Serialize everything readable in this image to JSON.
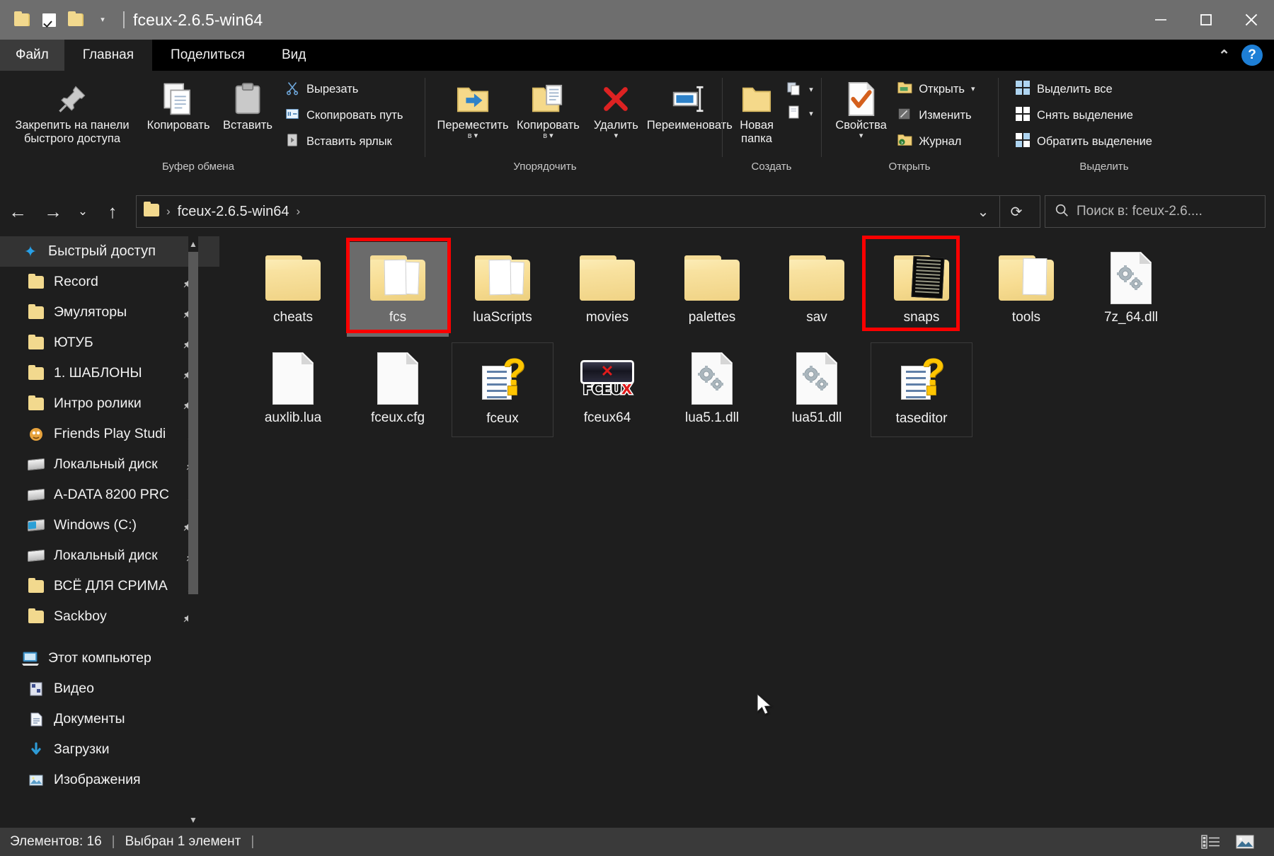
{
  "window": {
    "title": "fceux-2.6.5-win64",
    "quick_access_icons": [
      "folder-icon",
      "checkbox-icon",
      "folder-icon",
      "dropdown-caret-icon"
    ],
    "controls": {
      "minimize": "minimize-icon",
      "maximize": "maximize-icon",
      "close": "close-icon"
    }
  },
  "tabs": [
    {
      "label": "Файл",
      "id": "file"
    },
    {
      "label": "Главная",
      "id": "home",
      "active": true
    },
    {
      "label": "Поделиться",
      "id": "share"
    },
    {
      "label": "Вид",
      "id": "view"
    }
  ],
  "ribbon": {
    "collapse_icon": "chevron-up-icon",
    "help_icon": "help-icon",
    "help_label": "?",
    "groups": [
      {
        "label": "Буфер обмена",
        "big_buttons": [
          {
            "label": "Закрепить на панели\nбыстрого доступа",
            "icon": "pin-icon"
          },
          {
            "label": "Копировать",
            "icon": "copy-icon"
          },
          {
            "label": "Вставить",
            "icon": "paste-icon"
          }
        ],
        "small_buttons": [
          {
            "label": "Вырезать",
            "icon": "scissors-icon"
          },
          {
            "label": "Скопировать путь",
            "icon": "copy-path-icon"
          },
          {
            "label": "Вставить ярлык",
            "icon": "paste-shortcut-icon"
          }
        ]
      },
      {
        "label": "Упорядочить",
        "big_buttons": [
          {
            "label": "Переместить\nв",
            "icon": "move-to-icon",
            "has_caret": true
          },
          {
            "label": "Копировать\nв",
            "icon": "copy-to-icon",
            "has_caret": true
          },
          {
            "label": "Удалить",
            "icon": "delete-icon",
            "has_caret": true
          },
          {
            "label": "Переименовать",
            "icon": "rename-icon"
          }
        ]
      },
      {
        "label": "Создать",
        "big_buttons": [
          {
            "label": "Новая\nпапка",
            "icon": "new-folder-icon"
          }
        ],
        "split_items": [
          {
            "icon": "new-item-icon",
            "has_caret": true
          },
          {
            "icon": "easy-access-icon",
            "has_caret": true
          }
        ]
      },
      {
        "label": "Открыть",
        "big_buttons": [
          {
            "label": "Свойства",
            "icon": "properties-icon",
            "has_caret": true
          }
        ],
        "small_buttons": [
          {
            "label": "Открыть",
            "icon": "open-icon",
            "has_caret": true
          },
          {
            "label": "Изменить",
            "icon": "edit-icon"
          },
          {
            "label": "Журнал",
            "icon": "history-icon"
          }
        ]
      },
      {
        "label": "Выделить",
        "small_buttons": [
          {
            "label": "Выделить все",
            "icon": "select-all-icon"
          },
          {
            "label": "Снять выделение",
            "icon": "select-none-icon"
          },
          {
            "label": "Обратить выделение",
            "icon": "invert-selection-icon"
          }
        ]
      }
    ]
  },
  "navbar": {
    "back_icon": "back-arrow-icon",
    "forward_icon": "forward-arrow-icon",
    "recent_icon": "recent-locations-icon",
    "up_icon": "up-arrow-icon",
    "breadcrumbs": [
      "fceux-2.6.5-win64"
    ],
    "dropdown_icon": "chevron-down-icon",
    "refresh_icon": "refresh-icon",
    "search_icon": "search-icon",
    "search_placeholder": "Поиск в: fceux-2.6...."
  },
  "sidebar": {
    "quick_access": {
      "label": "Быстрый доступ",
      "icon": "star-icon",
      "items": [
        {
          "label": "Record",
          "icon": "folder-icon",
          "pinned": true
        },
        {
          "label": "Эмуляторы",
          "icon": "folder-icon",
          "pinned": true
        },
        {
          "label": "ЮТУБ",
          "icon": "folder-icon",
          "pinned": true
        },
        {
          "label": "1. ШАБЛОНЫ",
          "icon": "folder-icon",
          "pinned": true
        },
        {
          "label": "Интро ролики",
          "icon": "folder-icon",
          "pinned": true
        },
        {
          "label": "Friends Play Studi",
          "icon": "app-folder-icon",
          "pinned": true
        },
        {
          "label": "Локальный диск",
          "icon": "drive-icon",
          "pinned": true
        },
        {
          "label": "A-DATA 8200 PRC",
          "icon": "drive-icon",
          "pinned": true
        },
        {
          "label": "Windows (C:)",
          "icon": "windows-drive-icon",
          "pinned": true
        },
        {
          "label": "Локальный диск",
          "icon": "drive-icon",
          "pinned": true
        },
        {
          "label": "ВСЁ ДЛЯ СРИМА",
          "icon": "folder-icon",
          "pinned": true
        },
        {
          "label": "Sackboy",
          "icon": "folder-icon",
          "pinned": true
        }
      ]
    },
    "this_pc": {
      "label": "Этот компьютер",
      "icon": "computer-icon",
      "items": [
        {
          "label": "Видео",
          "icon": "videos-icon"
        },
        {
          "label": "Документы",
          "icon": "documents-icon"
        },
        {
          "label": "Загрузки",
          "icon": "downloads-icon"
        },
        {
          "label": "Изображения",
          "icon": "pictures-icon"
        }
      ]
    }
  },
  "files": [
    {
      "name": "cheats",
      "type": "folder",
      "selected": false
    },
    {
      "name": "fcs",
      "type": "folder-docs",
      "selected": true,
      "annotated": true
    },
    {
      "name": "luaScripts",
      "type": "folder-docs",
      "selected": false
    },
    {
      "name": "movies",
      "type": "folder",
      "selected": false
    },
    {
      "name": "palettes",
      "type": "folder",
      "selected": false
    },
    {
      "name": "sav",
      "type": "folder",
      "selected": false
    },
    {
      "name": "snaps",
      "type": "folder-snap",
      "selected": false,
      "annotated": true
    },
    {
      "name": "tools",
      "type": "folder-doc1",
      "selected": false
    },
    {
      "name": "7z_64.dll",
      "type": "dll",
      "selected": false
    },
    {
      "name": "auxlib.lua",
      "type": "blank-doc",
      "selected": false
    },
    {
      "name": "fceux.cfg",
      "type": "blank-doc",
      "selected": false
    },
    {
      "name": "fceux",
      "type": "help",
      "selected": false
    },
    {
      "name": "fceux64",
      "type": "fceux-app",
      "selected": false
    },
    {
      "name": "lua5.1.dll",
      "type": "dll",
      "selected": false
    },
    {
      "name": "lua51.dll",
      "type": "dll",
      "selected": false
    },
    {
      "name": "taseditor",
      "type": "help",
      "selected": false
    }
  ],
  "statusbar": {
    "item_count": "Элементов: 16",
    "selection": "Выбран 1 элемент",
    "view_list_icon": "details-view-icon",
    "view_icons_icon": "large-icons-view-icon"
  },
  "colors": {
    "annotation": "#fb0000",
    "selection": "#6b6b6b",
    "titlebar": "#6e6e6e",
    "background": "#1e1e1e",
    "statusbar": "#3a3a3a",
    "accent": "#1e7fd6"
  }
}
